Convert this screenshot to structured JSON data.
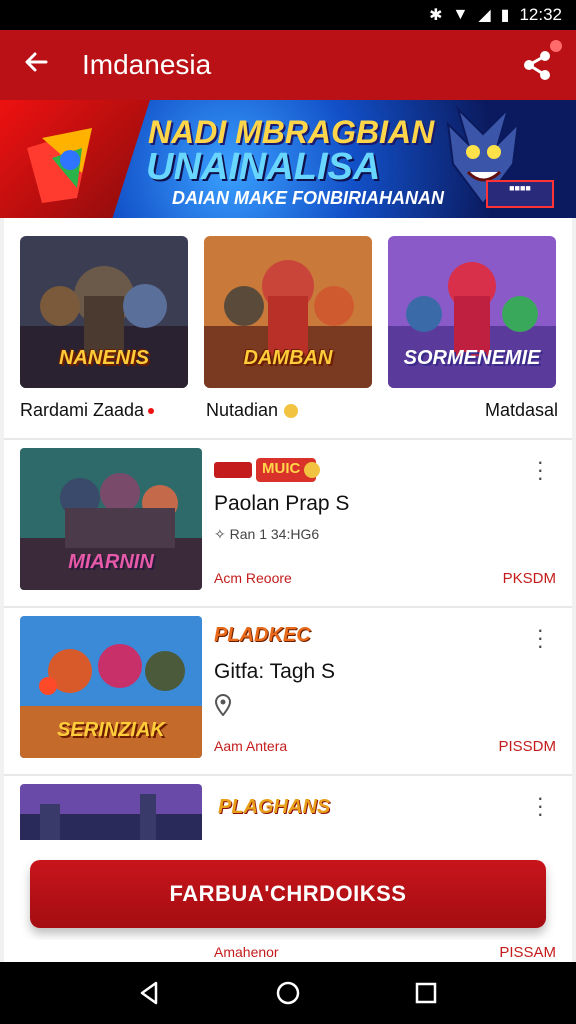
{
  "status": {
    "time": "12:32"
  },
  "appbar": {
    "title": "Imdanesia"
  },
  "banner": {
    "line1": "NADI MBRAGBIAN",
    "line2": "UNAINALISA",
    "line3": "DAIAN MAKE FONBIRIAHANAN"
  },
  "grid": [
    {
      "name": "NANENIS",
      "caption": "Rardami Zaada"
    },
    {
      "name": "DAMBAN",
      "caption": "Nutadian"
    },
    {
      "name": "SORMENEMIE",
      "caption": "Matdasal"
    }
  ],
  "rows": [
    {
      "image_title": "MIARNIN",
      "badge": "MUIC",
      "title": "Paolan Prap S",
      "meta": "Ran 1 34:HG6",
      "left": "Acm Reoore",
      "right": "PKSDM"
    },
    {
      "image_title": "SERINZIAK",
      "badge": "PLADKEC",
      "title": "Gitfa: Tagh S",
      "meta": "",
      "left": "Aam Antera",
      "right": "PISSDM"
    },
    {
      "image_title": "",
      "badge": "PLAGHANS",
      "title": "",
      "meta": "",
      "left": "Amahenor",
      "right": "PISSAM"
    }
  ],
  "cta": {
    "label": "FARBUA'CHRDOIKSS"
  },
  "colors": {
    "primary": "#b91116",
    "accent": "#c41c1c"
  }
}
